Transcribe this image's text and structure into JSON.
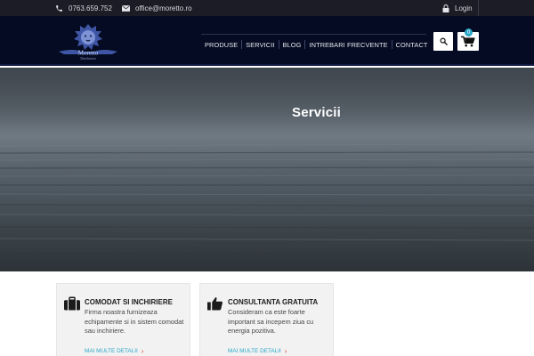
{
  "topbar": {
    "phone": "0763.659.752",
    "phone_icon": "phone-icon",
    "email": "office@moretto.ro",
    "email_icon": "envelope-icon",
    "login_label": "Login",
    "login_icon": "lock-icon"
  },
  "header": {
    "logo_icon": "lion-logo-icon",
    "logo_text": "Moretto",
    "logo_subtext": "Distribution",
    "nav": [
      {
        "label": "PRODUSE"
      },
      {
        "label": "SERVICII"
      },
      {
        "label": "BLOG"
      },
      {
        "label": "INTREBARI FRECVENTE"
      },
      {
        "label": "CONTACT"
      }
    ],
    "search_icon": "search-icon",
    "cart_icon": "shopping-cart-icon",
    "cart_count": "0"
  },
  "hero": {
    "title": "Servicii"
  },
  "services": [
    {
      "icon": "briefcase-icon",
      "title": "COMODAT SI INCHIRIERE",
      "text": "Firma noastra furnizeaza echipamente si in sistem comodat sau inchiriere.",
      "more": "MAI MULTE DETALII"
    },
    {
      "icon": "thumbs-up-icon",
      "title": "CONSULTANTA GRATUITA",
      "text": "Consideram ca este foarte important sa incepem ziua cu energia pozitiva.",
      "more": "MAI MULTE DETALII"
    }
  ],
  "colors": {
    "topbar_bg": "#1c1c26",
    "header_bg": "#050b22",
    "accent": "#2aa7c8",
    "arrow": "#e0463a"
  }
}
